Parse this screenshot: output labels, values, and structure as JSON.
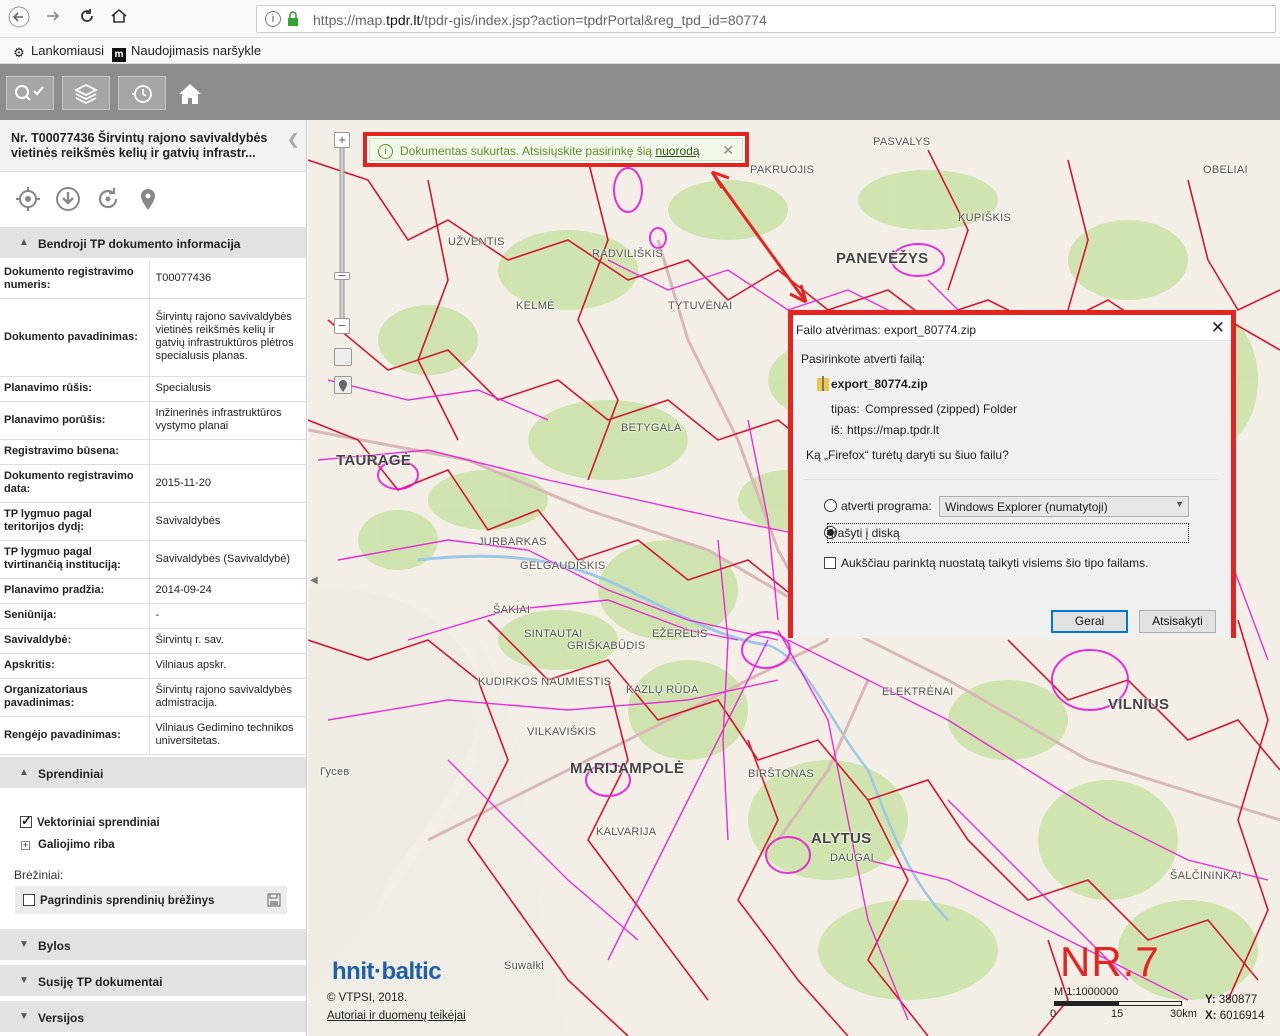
{
  "browser": {
    "url_prefix": "https://map.",
    "url_domain": "tpdr.lt",
    "url_rest": "/tpdr-gis/index.jsp?action=tpdrPortal&reg_tpd_id=80774",
    "bookmarks": [
      "Lankomiausi",
      "Naudojimasis naršykle"
    ]
  },
  "toolbar": {
    "buttons": [
      "search-check",
      "layers",
      "history",
      "home"
    ]
  },
  "panel": {
    "title": "Nr. T00077436 Širvintų rajono savivaldybės vietinės reikšmės kelių ir gatvių infrastr...",
    "sections": {
      "general": "Bendroji TP dokumento informacija",
      "solutions": "Sprendiniai",
      "files": "Bylos",
      "related": "Susiję TP dokumentai",
      "versions": "Versijos"
    },
    "info_rows": [
      {
        "key": "Dokumento registravimo numeris:",
        "value": "T00077436"
      },
      {
        "key": "Dokumento pavadinimas:",
        "value": "Širvintų rajono savivaldybės vietinės reikšmės kelių ir gatvių infrastruktūros plėtros specialusis planas."
      },
      {
        "key": "Planavimo rūšis:",
        "value": "Specialusis"
      },
      {
        "key": "Planavimo porūšis:",
        "value": "Inžinerinės infrastruktūros vystymo planai"
      },
      {
        "key": "Registravimo būsena:",
        "value": ""
      },
      {
        "key": "Dokumento registravimo data:",
        "value": "2015-11-20"
      },
      {
        "key": "TP lygmuo pagal teritorijos dydį:",
        "value": "Savivaldybės"
      },
      {
        "key": "TP lygmuo pagal tvirtinančią instituciją:",
        "value": "Savivaldybės (Savivaldybė)"
      },
      {
        "key": "Planavimo pradžia:",
        "value": "2014-09-24"
      },
      {
        "key": "Seniūnija:",
        "value": "-"
      },
      {
        "key": "Savivaldybė:",
        "value": "Širvintų r. sav."
      },
      {
        "key": "Apskritis:",
        "value": "Vilniaus apskr."
      },
      {
        "key": "Organizatoriaus pavadinimas:",
        "value": "Širvintų rajono savivaldybės admistracija."
      },
      {
        "key": "Rengėjo pavadinimas:",
        "value": "Vilniaus Gedimino technikos universitetas."
      }
    ],
    "vector_solutions": "Vektoriniai sprendiniai",
    "validity_border": "Galiojimo riba",
    "drawings_label": "Brėžiniai:",
    "main_drawings": "Pagrindinis sprendinių brėžinys"
  },
  "map": {
    "notification_text": "Dokumentas sukurtas. Atsisiųskite pasirinkę šią",
    "notification_link": "nuorodą",
    "place_labels": [
      {
        "name": "PASVALYS",
        "big": false
      },
      {
        "name": "PAKRUOJIS",
        "big": false
      },
      {
        "name": "PANEVĖŽYS",
        "big": true
      },
      {
        "name": "KUPIŠKIS",
        "big": false
      },
      {
        "name": "OBELIAI",
        "big": false
      },
      {
        "name": "RADVILIŠKIS",
        "big": false
      },
      {
        "name": "UŽVENTIS",
        "big": false
      },
      {
        "name": "KELMĖ",
        "big": false
      },
      {
        "name": "TYTUVĖNAI",
        "big": false
      },
      {
        "name": "BETYGALA",
        "big": false
      },
      {
        "name": "TAURAGĖ",
        "big": true
      },
      {
        "name": "JURBARKAS",
        "big": false
      },
      {
        "name": "GELGAUDIŠKIS",
        "big": false
      },
      {
        "name": "ŠAKIAI",
        "big": false
      },
      {
        "name": "SINTAUTAI",
        "big": false
      },
      {
        "name": "GRIŠKABŪDIS",
        "big": false
      },
      {
        "name": "EŽERĖLIS",
        "big": false
      },
      {
        "name": "KAZLŲ RŪDA",
        "big": false
      },
      {
        "name": "KUDIRKOS NAUMIESTIS",
        "big": false
      },
      {
        "name": "VILKAVIŠKIS",
        "big": false
      },
      {
        "name": "MARIJAMPOLĖ",
        "big": true
      },
      {
        "name": "KALVARIJA",
        "big": false
      },
      {
        "name": "ALYTUS",
        "big": true
      },
      {
        "name": "BIRŠTONAS",
        "big": false
      },
      {
        "name": "DAUGAI",
        "big": false
      },
      {
        "name": "ELEKTRĖNAI",
        "big": false
      },
      {
        "name": "VILNIUS",
        "big": true
      },
      {
        "name": "ŠALČININKAI",
        "big": false
      },
      {
        "name": "Suwałki",
        "big": false
      },
      {
        "name": "Гусев",
        "big": false
      }
    ],
    "logo": "hnit·baltic",
    "copyright": "© VTPSI, 2018.",
    "attribution": "Autoriai ir duomenų teikėjai",
    "watermark": "NR.7",
    "scale": {
      "label": "M 1:1000000",
      "ticks": [
        "0",
        "15",
        "30km"
      ]
    },
    "coords": {
      "y_label": "Y:",
      "y": "380877",
      "x_label": "X:",
      "x": "6016914"
    }
  },
  "dialog": {
    "title": "Failo atvėrimas: export_80774.zip",
    "intro": "Pasirinkote atverti failą:",
    "file_name": "export_80774.zip",
    "type_label": "tipas:",
    "type_value": "Compressed (zipped) Folder",
    "from_label": "iš:",
    "from_value": "https://map.tpdr.lt",
    "question": "Ką „Firefox“ turėtų daryti su šiuo failu?",
    "open_with_label": "atverti programa:",
    "open_with_value": "Windows Explorer (numatytoji)",
    "save_label": "įrašyti į diską",
    "remember_label": "Aukščiau parinktą nuostatą taikyti visiems šio tipo failams.",
    "ok_button": "Gerai",
    "cancel_button": "Atsisakyti",
    "selected_option": "save"
  },
  "colors": {
    "highlight": "#e52420",
    "plan_lines": "#e81ad6",
    "borders": "#d6162e",
    "notification": "#5d8f2a"
  }
}
